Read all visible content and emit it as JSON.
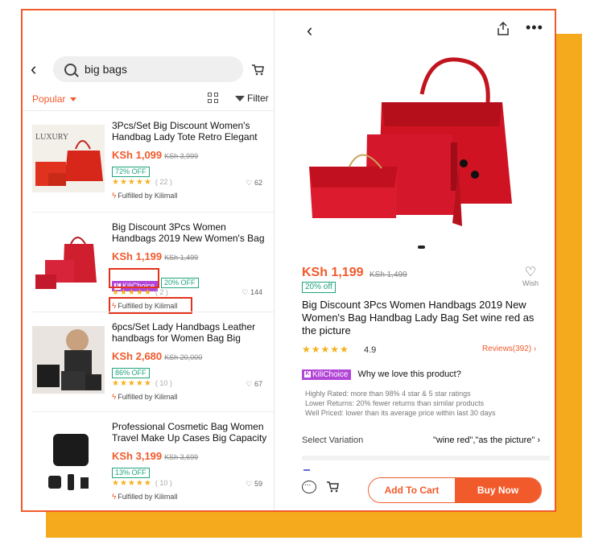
{
  "search": {
    "query": "big bags"
  },
  "sort": {
    "label": "Popular"
  },
  "filter": {
    "label": "Filter"
  },
  "products": [
    {
      "title": "3Pcs/Set Big Discount Women's Handbag Lady Tote Retro Elegant",
      "price": "KSh 1,099",
      "old_price": "KSh 3,999",
      "discount": "72% OFF",
      "reviews": "( 22 )",
      "likes": "62",
      "fulfilled": "Fulfilled by Kilimall",
      "thumb_label": "LUXURY"
    },
    {
      "title": "Big Discount 3Pcs Women Handbags 2019 New Women's Bag",
      "price": "KSh 1,199",
      "old_price": "KSh 1,499",
      "badge": "KiliChoice",
      "discount": "20% OFF",
      "reviews": "( 2 )",
      "likes": "144",
      "fulfilled": "Fulfilled by Kilimall"
    },
    {
      "title": "6pcs/Set Lady Handbags Leather handbags for Women Bag Big",
      "price": "KSh 2,680",
      "old_price": "KSh 20,000",
      "discount": "86% OFF",
      "reviews": "( 10 )",
      "likes": "67",
      "fulfilled": "Fulfilled by Kilimall"
    },
    {
      "title": "Professional Cosmetic Bag Women Travel Make Up Cases Big Capacity",
      "price": "KSh 3,199",
      "old_price": "KSh 3,699",
      "discount": "13% OFF",
      "reviews": "( 10 )",
      "likes": "59",
      "fulfilled": "Fulfilled by Kilimall"
    }
  ],
  "detail": {
    "price": "KSh 1,199",
    "old_price": "KSh 1,499",
    "discount": "20% off",
    "wish_label": "Wish",
    "title": "Big Discount 3Pcs Women Handbags 2019 New Women's Bag Handbag Lady Bag Set wine red as the picture",
    "rating": "4.9",
    "reviews": "Reviews(392)",
    "badge": "KiliChoice",
    "why_label": "Why we love this product?",
    "points": [
      "Highly Rated: more than 98% 4 star & 5 star ratings",
      "Lower Returns: 20% fewer returns than similar products",
      "Well Priced: lower than its average price within last 30 days"
    ],
    "variation_label": "Select Variation",
    "variation_value": "\"wine red\",\"as the picture\"",
    "add_to_cart": "Add To Cart",
    "buy_now": "Buy Now"
  },
  "colors": {
    "accent": "#f15a2b",
    "frame_bg": "#f5a91d",
    "kili": "#b246d8",
    "green": "#1fa57d",
    "star": "#f6b01e"
  }
}
